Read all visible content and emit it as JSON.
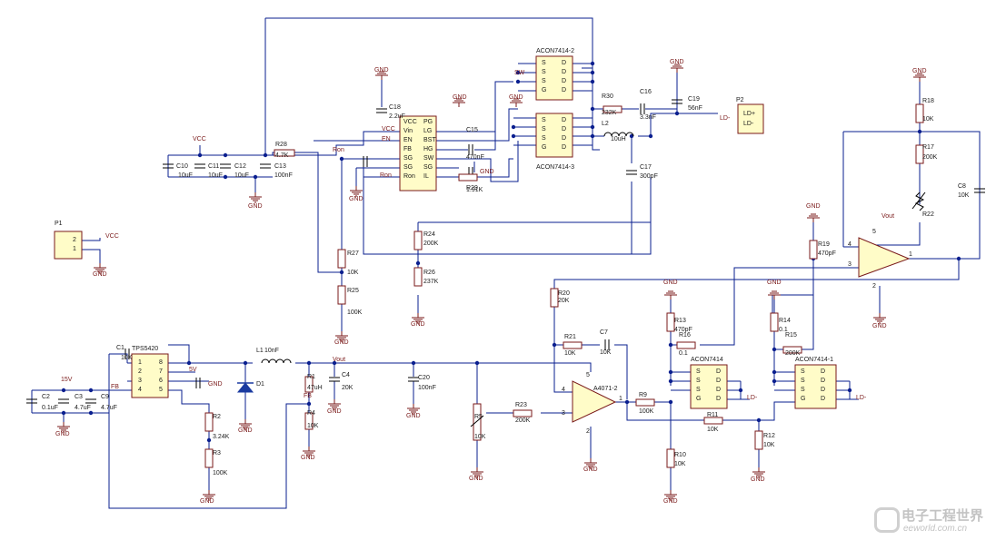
{
  "components": {
    "labels": [
      "C10",
      "C11",
      "C12",
      "C13",
      "R28",
      "C18",
      "C15",
      "C16",
      "C19",
      "R30",
      "L2",
      "C17",
      "R29",
      "P2",
      "R18",
      "R17",
      "R22",
      "C8",
      "R19",
      "R24",
      "R26",
      "R27",
      "R25",
      "R20",
      "R21",
      "C7",
      "R13",
      "R14",
      "R16",
      "R15",
      "R23",
      "R5",
      "R9",
      "R11",
      "R10",
      "R12",
      "C1",
      "L1",
      "D1",
      "R1",
      "R4",
      "R2",
      "R3",
      "C4",
      "C20",
      "C2",
      "C3",
      "C9",
      "P1"
    ],
    "values": [
      "10uF",
      "10uF",
      "10uF",
      "100nF",
      "4.7K",
      "2.2uF",
      "470nF",
      "3.3nF",
      "56nF",
      "232K",
      "10uH",
      "300pF",
      "1.91K",
      "10K",
      "200K",
      "10K",
      "470pF",
      "200K",
      "237K",
      "10K",
      "100K",
      "20K",
      "10K",
      "10K",
      "470pF",
      "0.1",
      "0.1",
      "200K",
      "200K",
      "10K",
      "100K",
      "10K",
      "10K",
      "10K",
      "10K",
      "10nF",
      "47uH",
      "10K",
      "3.24K",
      "100K",
      "20K",
      "100nF",
      "0.1uF",
      "4.7uF",
      "4.7uF",
      "4.7uF",
      "1.5nF"
    ]
  },
  "ics": {
    "u1": "ACON7414-2",
    "u2": "ACON7414-3",
    "u3": "ACON7414",
    "u4": "ACON7414-1",
    "u5": "TPS5420",
    "u6": "A4071-2"
  },
  "pins": {
    "mos": [
      "S",
      "S",
      "S",
      "G",
      "D",
      "D",
      "D",
      "D"
    ],
    "driver_left": [
      "VCC",
      "Vin",
      "EN",
      "FB",
      "SG",
      "SG",
      "Ron"
    ],
    "driver_right": [
      "PG",
      "LG",
      "BST",
      "HG",
      "SW",
      "SG",
      "IL"
    ],
    "tps": [
      "1",
      "2",
      "3",
      "4",
      "8",
      "7",
      "6",
      "5"
    ],
    "opamp": [
      "4",
      "3",
      "1",
      "5",
      "2"
    ],
    "connectors": [
      "2",
      "1",
      "LD+",
      "LD-"
    ]
  },
  "nets": {
    "vcc": "VCC",
    "vout": "Vout",
    "v15": "15V",
    "v5": "5V",
    "fb": "FB",
    "gnd": "GND",
    "sw": "SW",
    "ron": "Ron",
    "en": "EN",
    "ldm": "LD-"
  },
  "watermark": {
    "brand": "电子工程世界",
    "url": "eeworld.com.cn"
  }
}
